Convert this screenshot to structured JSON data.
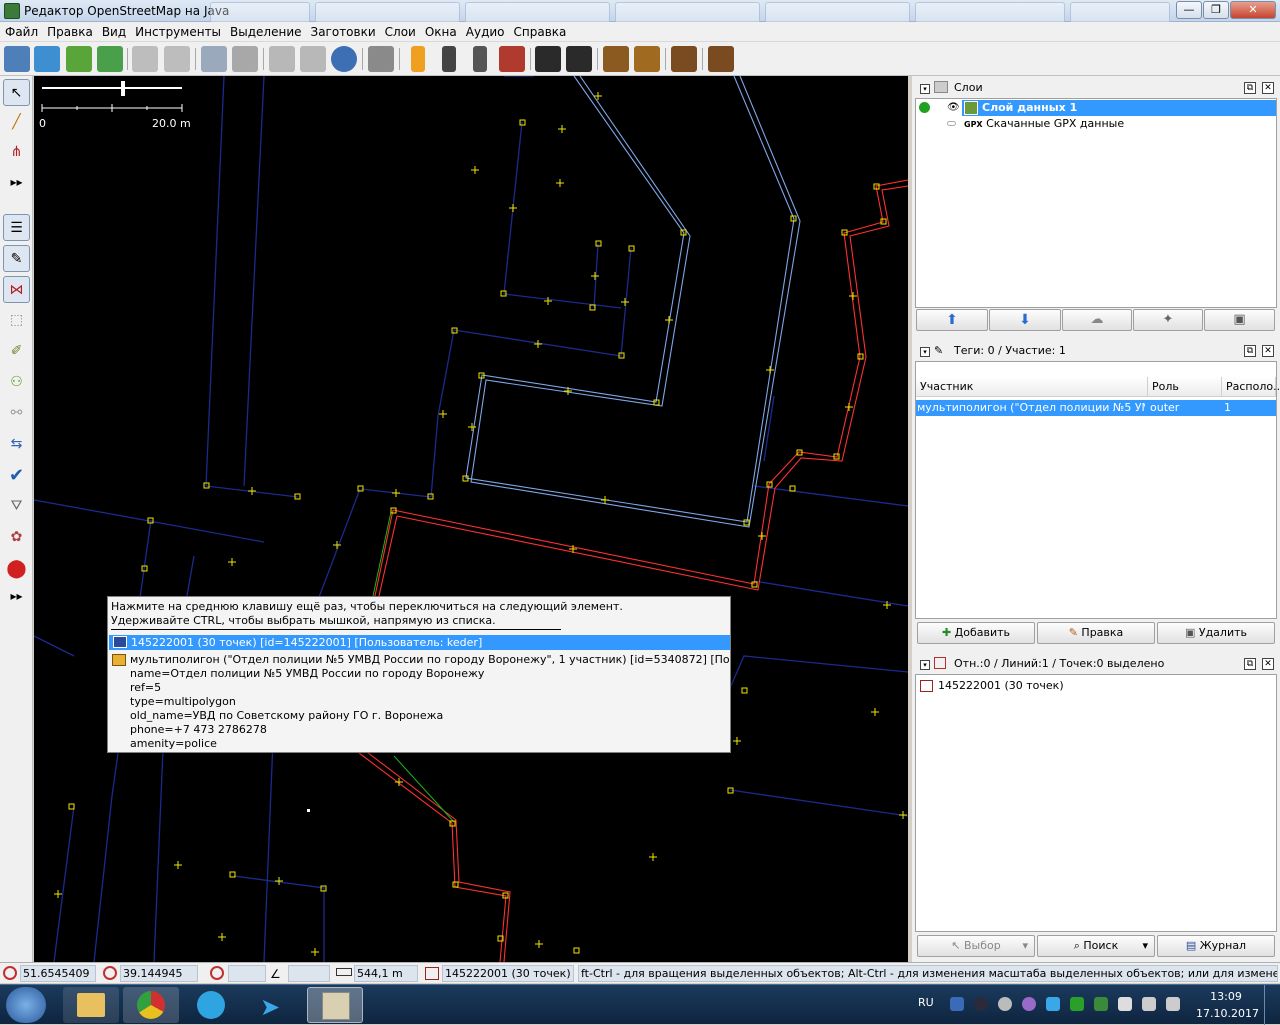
{
  "window": {
    "title": "Редактор OpenStreetMap на Java",
    "controls": {
      "minimize": "—",
      "maximize": "❐",
      "close": "✕"
    }
  },
  "menu": [
    "Файл",
    "Правка",
    "Вид",
    "Инструменты",
    "Выделение",
    "Заготовки",
    "Слои",
    "Окна",
    "Аудио",
    "Справка"
  ],
  "toolbar_icons": [
    "open-icon",
    "save-icon",
    "download-icon",
    "upload-icon",
    "undo-icon",
    "redo-icon",
    "zoom-icon",
    "preferences-icon",
    "split-way-icon",
    "combine-way-icon",
    "refresh-icon",
    "wireframe-icon",
    "traffic-light-icon",
    "railway-icon",
    "crossing-icon",
    "wall-icon",
    "car-icon",
    "bus-icon",
    "amenity-icon",
    "restaurant-icon",
    "castle-icon",
    "factory-icon"
  ],
  "left_tools": [
    "select-icon",
    "draw-icon",
    "improve-way-icon",
    "more-icon",
    "layers-toggle-icon",
    "tags-toggle-icon",
    "relations-toggle-icon",
    "selection-list-icon",
    "commands-icon",
    "authors-icon",
    "conflicts-icon",
    "validator-icon",
    "filter-icon",
    "map-paint-icon",
    "notes-icon",
    "more-icon"
  ],
  "map": {
    "scale_start": "0",
    "scale_end": "20.0 m"
  },
  "popup": {
    "hint1": "Нажмите на среднюю клавишу ещё раз, чтобы переключиться на следующий элемент.",
    "hint2": "Удерживайте CTRL, чтобы выбрать мышкой, напрямую из списка.",
    "selected": "145222001 (30 точек) [id=145222001] [Пользователь: keder]",
    "relation": "мультиполигон (\"Отдел полиции №5 УМВД России по городу Воронежу\", 1 участник) [id=5340872] [Пользователь: keder]",
    "tags": [
      "name=Отдел полиции №5 УМВД России по городу Воронежу",
      "ref=5",
      "type=multipolygon",
      "old_name=УВД по Советскому району ГО г. Воронежа",
      "phone=+7 473 2786278",
      "amenity=police"
    ]
  },
  "layers_panel": {
    "title": "Слои",
    "layers": [
      {
        "name": "Слой данных 1",
        "active": true
      },
      {
        "name": "Скачанные GPX данные",
        "active": false,
        "prefix": "GPX"
      }
    ]
  },
  "tags_panel": {
    "title": "Теги: 0 / Участие: 1",
    "columns": [
      "Участник",
      "Роль",
      "Располо..."
    ],
    "rows": [
      {
        "member": "мультиполигон (\"Отдел полиции №5 УМВ...",
        "role": "outer",
        "pos": "1"
      }
    ],
    "buttons": [
      "Добавить",
      "Правка",
      "Удалить"
    ]
  },
  "selection_panel": {
    "title": "Отн.:0 / Линий:1 / Точек:0 выделено",
    "items": [
      "145222001 (30 точек)"
    ],
    "buttons": [
      "Выбор",
      "Поиск",
      "Журнал"
    ]
  },
  "status": {
    "lat": "51.6545409",
    "lon": "39.144945",
    "distance": "544,1 m",
    "name": "145222001 (30 точек)",
    "help": "ft-Ctrl - для вращения выделенных объектов; Alt-Ctrl - для изменения масштаба выделенных объектов; или для изменения выделения"
  },
  "taskbar": {
    "lang": "RU",
    "time": "13:09",
    "date": "17.10.2017"
  }
}
